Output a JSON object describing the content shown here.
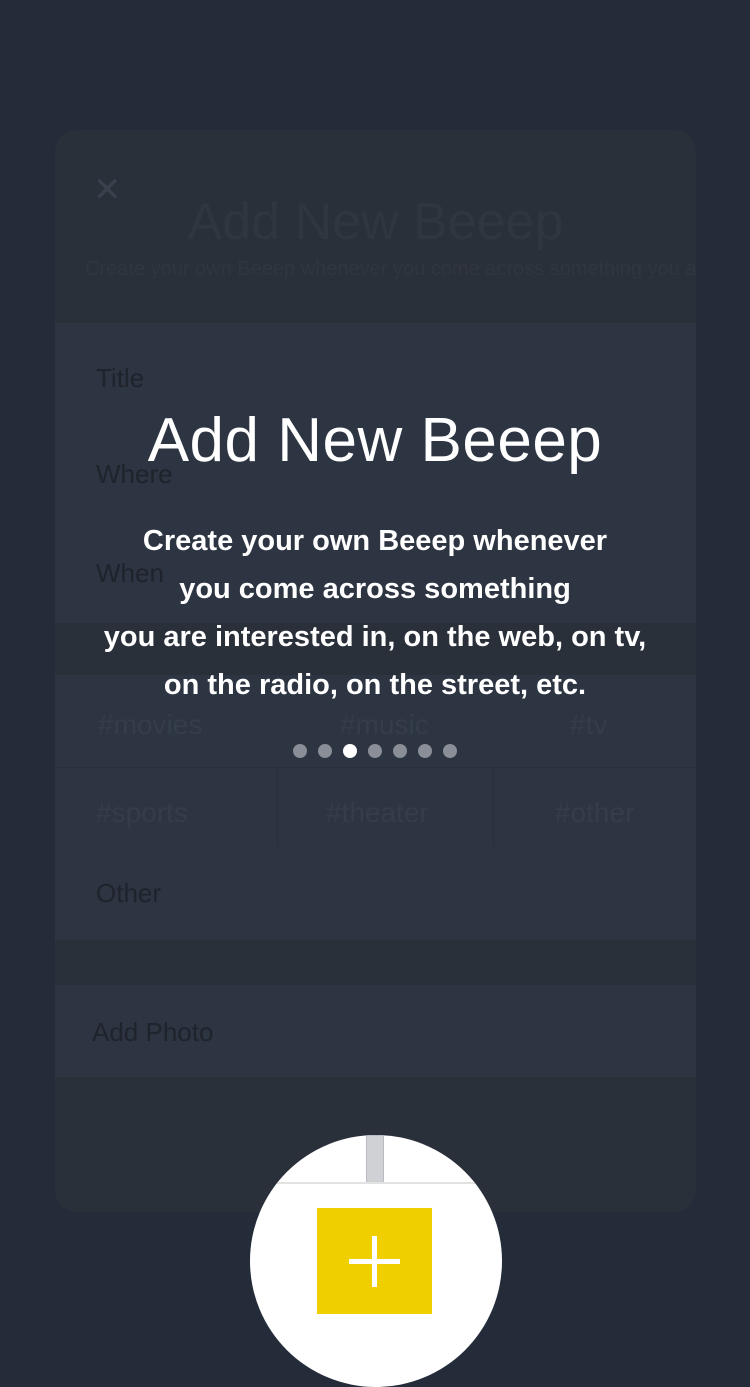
{
  "background_form": {
    "close_icon": "close-icon",
    "header_title": "Add New Beeep",
    "header_subtitle": "Create your own Beeep whenever you come across something you are interested in",
    "fields": [
      {
        "label": "Title"
      },
      {
        "label": "Where"
      },
      {
        "label": "When"
      }
    ],
    "tags_row1": [
      "#movies",
      "#music",
      "#tv"
    ],
    "tags_row2": [
      "#sports",
      "#theater",
      "#other"
    ],
    "other_label": "Other",
    "add_photo_label": "Add Photo"
  },
  "overlay": {
    "title": "Add New Beeep",
    "description_lines": [
      "Create your own Beeep whenever",
      "you come across something",
      "you are interested in, on the web, on tv,",
      "on the radio, on the street, etc."
    ]
  },
  "pagination": {
    "total": 7,
    "active_index": 2
  },
  "spotlight": {
    "button_icon": "plus-icon"
  },
  "colors": {
    "background": "#242c3a",
    "accent": "#f0cf00",
    "text": "#ffffff",
    "dot_inactive": "#8a8e96",
    "dot_active": "#ffffff"
  }
}
